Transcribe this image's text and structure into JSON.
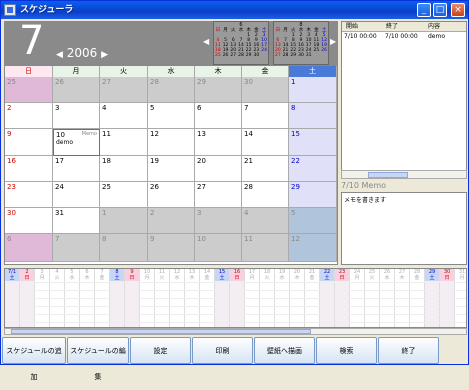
{
  "window": {
    "title": "スケジューラ"
  },
  "header": {
    "day": "7",
    "year": "2006"
  },
  "mini_cals": [
    {
      "month": "6",
      "days": [
        "日",
        "月",
        "火",
        "水",
        "木",
        "金",
        "土"
      ],
      "dates": [
        "",
        "",
        "",
        "",
        "1",
        "2",
        "3",
        "4",
        "5",
        "6",
        "7",
        "8",
        "9",
        "10",
        "11",
        "12",
        "13",
        "14",
        "15",
        "16",
        "17",
        "18",
        "19",
        "20",
        "21",
        "22",
        "23",
        "24",
        "25",
        "26",
        "27",
        "28",
        "29",
        "30",
        ""
      ]
    },
    {
      "month": "8",
      "days": [
        "日",
        "月",
        "火",
        "水",
        "木",
        "金",
        "土"
      ],
      "dates": [
        "",
        "",
        "1",
        "2",
        "3",
        "4",
        "5",
        "6",
        "7",
        "8",
        "9",
        "10",
        "11",
        "12",
        "13",
        "14",
        "15",
        "16",
        "17",
        "18",
        "19",
        "20",
        "21",
        "22",
        "23",
        "24",
        "25",
        "26",
        "27",
        "28",
        "29",
        "30",
        "31",
        "",
        ""
      ]
    }
  ],
  "weekdays": [
    "日",
    "月",
    "火",
    "水",
    "木",
    "金",
    "土"
  ],
  "weeks": [
    [
      "25",
      "26",
      "27",
      "28",
      "29",
      "30",
      "1"
    ],
    [
      "2",
      "3",
      "4",
      "5",
      "6",
      "7",
      "8"
    ],
    [
      "9",
      "10",
      "11",
      "12",
      "13",
      "14",
      "15"
    ],
    [
      "16",
      "17",
      "18",
      "19",
      "20",
      "21",
      "22"
    ],
    [
      "23",
      "24",
      "25",
      "26",
      "27",
      "28",
      "29"
    ],
    [
      "30",
      "31",
      "1",
      "2",
      "3",
      "4",
      "5"
    ],
    [
      "6",
      "7",
      "8",
      "9",
      "10",
      "11",
      "12"
    ]
  ],
  "selected": {
    "memo_label": "Memo",
    "event": "demo"
  },
  "list": {
    "headers": [
      "開始",
      "終了",
      "内容"
    ],
    "rows": [
      [
        "7/10 00:00",
        "7/10 00:00",
        "demo"
      ]
    ]
  },
  "memo": {
    "title": "7/10 Memo",
    "text": "メモを書きます"
  },
  "timeline": {
    "dates": [
      "7/1",
      "2",
      "3",
      "4",
      "5",
      "6",
      "7",
      "8",
      "9",
      "10",
      "11",
      "12",
      "13",
      "14",
      "15",
      "16",
      "17",
      "18",
      "19",
      "20",
      "21",
      "22",
      "23",
      "24",
      "25",
      "26",
      "27",
      "28",
      "29",
      "30",
      "31"
    ],
    "days": [
      "土",
      "日",
      "月",
      "火",
      "水",
      "木",
      "金",
      "土",
      "日",
      "月",
      "火",
      "水",
      "木",
      "金",
      "土",
      "日",
      "月",
      "火",
      "水",
      "木",
      "金",
      "土",
      "日",
      "月",
      "火",
      "水",
      "木",
      "金",
      "土",
      "日",
      "月"
    ]
  },
  "buttons": [
    "スケジュールの追加",
    "スケジュールの編集",
    "設定",
    "印刷",
    "壁紙へ描画",
    "検索",
    "終了"
  ],
  "colors": {
    "sunday": "#e8b8d8",
    "saturday": "#dcdcf4",
    "other_month": "#c8c8c8",
    "selected_border": "#4a8a4a"
  }
}
